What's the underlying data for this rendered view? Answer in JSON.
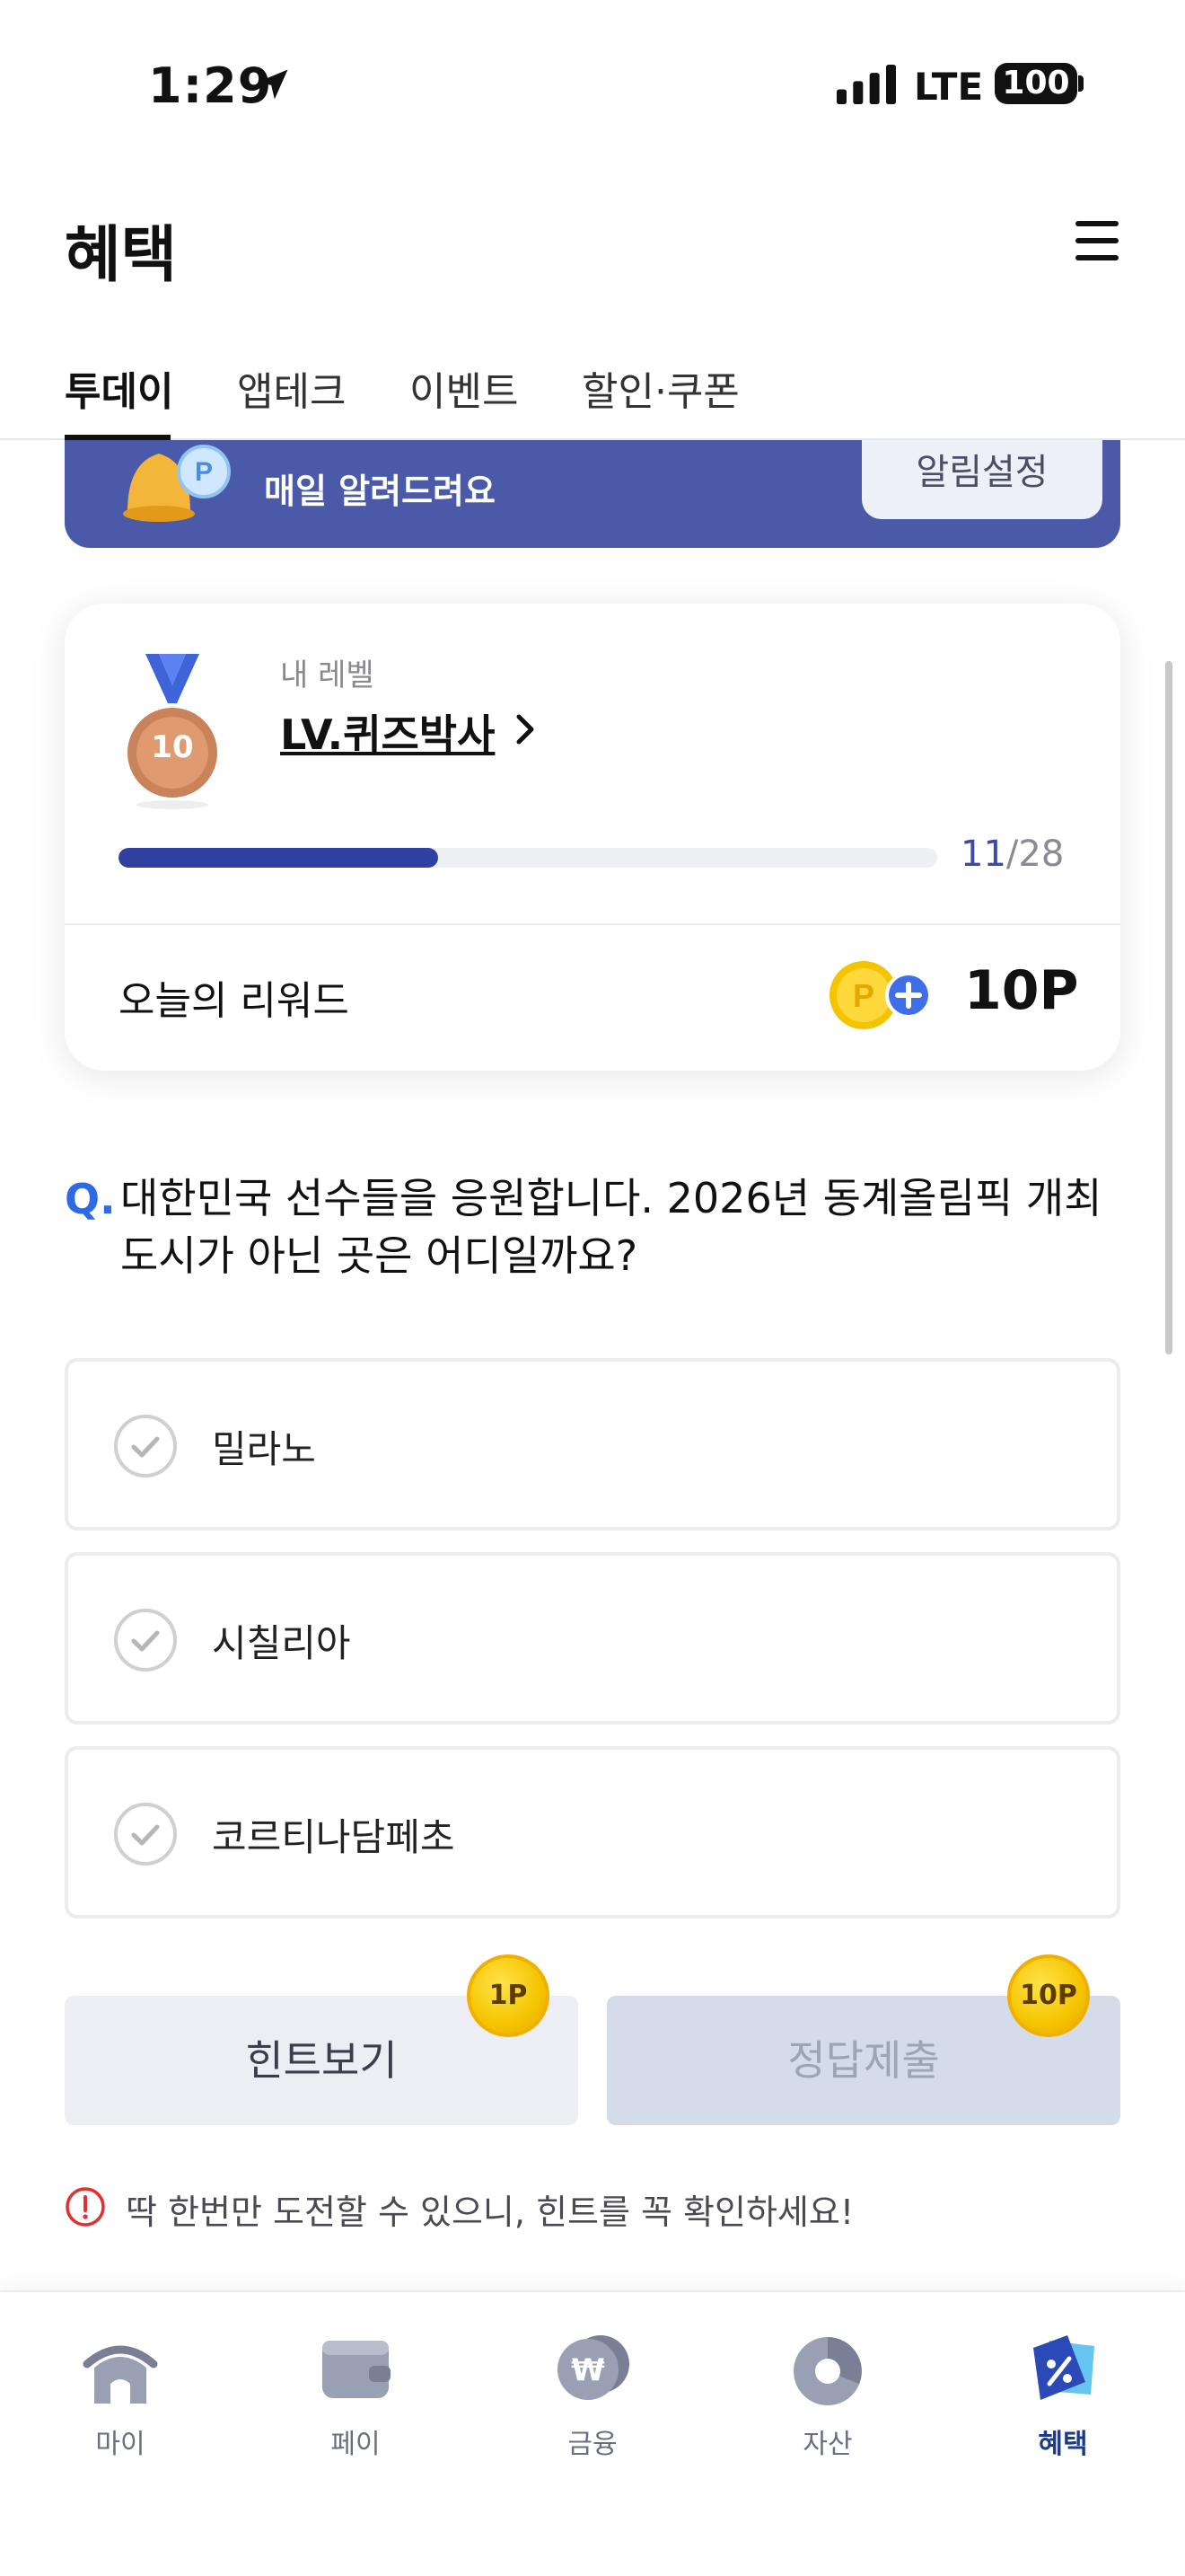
{
  "status_bar": {
    "time": "1:29",
    "network": "LTE",
    "battery": "100",
    "icons": [
      "location-arrow-icon",
      "signal-icon"
    ]
  },
  "header": {
    "title": "혜택",
    "menu_icon": "hamburger-menu-icon"
  },
  "tabs": [
    {
      "label": "투데이",
      "active": true
    },
    {
      "label": "앱테크",
      "active": false
    },
    {
      "label": "이벤트",
      "active": false
    },
    {
      "label": "할인·쿠폰",
      "active": false
    }
  ],
  "banner": {
    "text": "매일 알려드려요",
    "button_label": "알림설정",
    "background": "#4a5aa8"
  },
  "level_card": {
    "caption": "내 레벨",
    "level_name": "LV.퀴즈박사",
    "medal_number": "10",
    "progress_current": "11",
    "progress_total": "/28",
    "progress_fraction": 0.39,
    "reward_label": "오늘의 리워드",
    "reward_value": "10P"
  },
  "question": {
    "mark": "Q.",
    "text": "대한민국 선수들을 응원합니다. 2026년 동계올림픽 개최 도시가 아닌 곳은 어디일까요?"
  },
  "options": [
    {
      "label": "밀라노"
    },
    {
      "label": "시칠리아"
    },
    {
      "label": "코르티나담페초"
    }
  ],
  "actions": {
    "hint_label": "힌트보기",
    "hint_cost": "1P",
    "submit_label": "정답제출",
    "submit_reward": "10P"
  },
  "warning": "딱 한번만 도전할 수 있으니, 힌트를 꼭 확인하세요!",
  "bottom_nav": [
    {
      "label": "마이",
      "icon": "home-icon",
      "active": false
    },
    {
      "label": "페이",
      "icon": "wallet-icon",
      "active": false
    },
    {
      "label": "금융",
      "icon": "won-coin-icon",
      "active": false
    },
    {
      "label": "자산",
      "icon": "pie-chart-icon",
      "active": false
    },
    {
      "label": "혜택",
      "icon": "discount-tag-icon",
      "active": true
    }
  ],
  "colors": {
    "accent": "#3040a0",
    "question_mark": "#2f6ae6",
    "coin": "#f5c400"
  }
}
